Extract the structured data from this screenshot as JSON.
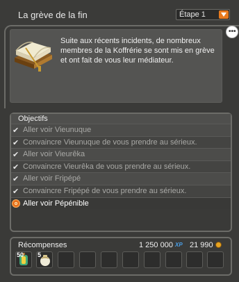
{
  "header": {
    "title": "La grève de la fin",
    "step_select": {
      "selected": "Étape 1"
    }
  },
  "description": {
    "text": "Suite aux récents incidents, de nombreux membres de la Koffrérie se sont mis en grève et ont fait de vous leur médiateur."
  },
  "objectives": {
    "title": "Objectifs",
    "items": [
      {
        "label": "Aller voir Vieunuque",
        "done": true
      },
      {
        "label": "Convaincre Vieunuque de vous prendre au sérieux.",
        "done": true
      },
      {
        "label": "Aller voir Vieurêka",
        "done": true
      },
      {
        "label": "Convaincre Vieurêka de vous prendre au sérieux.",
        "done": true
      },
      {
        "label": "Aller voir Fripépé",
        "done": true
      },
      {
        "label": "Convaincre Fripépé de vous prendre au sérieux.",
        "done": true
      },
      {
        "label": "Aller voir Pépénible",
        "done": false
      }
    ]
  },
  "rewards": {
    "title": "Récompenses",
    "xp": "1 250 000",
    "xp_tag": "XP",
    "kamas": "21 990",
    "items": [
      {
        "qty": "50",
        "icon": "lantern-icon"
      },
      {
        "qty": "5",
        "icon": "scroll-bag-icon"
      }
    ],
    "slot_count": 10
  },
  "colors": {
    "accent": "#e87a1e",
    "xp": "#4aa0e8",
    "kama": "#e8a420"
  }
}
